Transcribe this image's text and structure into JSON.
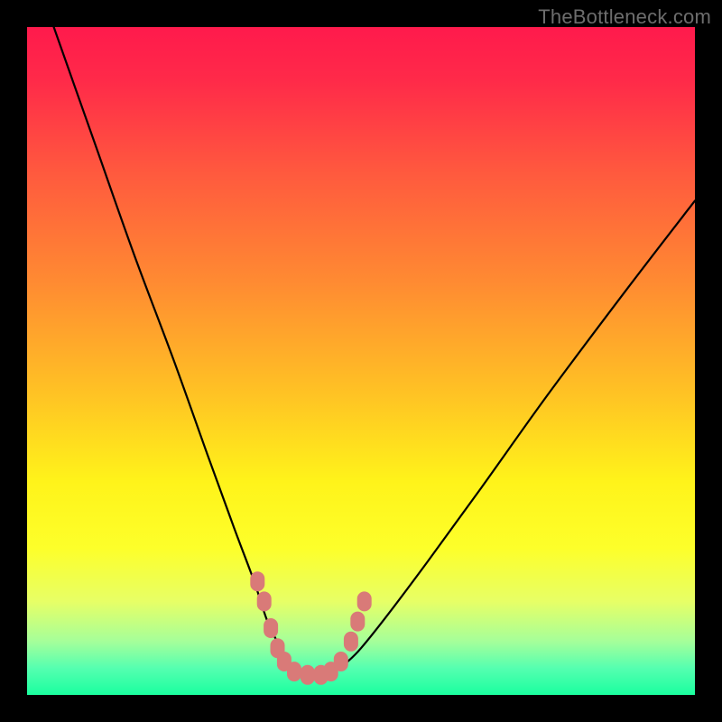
{
  "watermark": {
    "text": "TheBottleneck.com"
  },
  "colors": {
    "frame": "#000000",
    "curve": "#000000",
    "marker": "#d97a78",
    "gradient_stops": [
      {
        "offset": 0.0,
        "color": "#ff1a4c"
      },
      {
        "offset": 0.08,
        "color": "#ff2a49"
      },
      {
        "offset": 0.22,
        "color": "#ff5a3e"
      },
      {
        "offset": 0.38,
        "color": "#ff8a32"
      },
      {
        "offset": 0.55,
        "color": "#ffc324"
      },
      {
        "offset": 0.68,
        "color": "#fff31a"
      },
      {
        "offset": 0.78,
        "color": "#fdff2a"
      },
      {
        "offset": 0.86,
        "color": "#e7ff66"
      },
      {
        "offset": 0.92,
        "color": "#a5ff9a"
      },
      {
        "offset": 0.96,
        "color": "#55ffb0"
      },
      {
        "offset": 1.0,
        "color": "#1aff9f"
      }
    ]
  },
  "chart_data": {
    "type": "line",
    "title": "",
    "xlabel": "",
    "ylabel": "",
    "xlim": [
      0,
      100
    ],
    "ylim": [
      0,
      100
    ],
    "note": "Axes are unlabeled in the source image; values are relative percentages of the plot area (0 = bottom/left, 100 = top/right). The curve depicts a bottleneck-style V: steep descent from top-left to a flat minimum near x≈38–46, then a shallower rise toward the right.",
    "series": [
      {
        "name": "bottleneck-curve",
        "x": [
          4,
          10,
          16,
          22,
          27,
          31,
          34,
          36,
          38,
          40,
          42,
          44,
          46,
          48,
          50,
          54,
          60,
          68,
          78,
          90,
          100
        ],
        "values": [
          100,
          83,
          66,
          50,
          36,
          25,
          17,
          11,
          7,
          4,
          3,
          3,
          3.5,
          5,
          7,
          12,
          20,
          31,
          45,
          61,
          74
        ]
      }
    ],
    "markers": {
      "name": "highlighted-points",
      "note": "Pink rounded markers clustered around the curve minimum.",
      "points": [
        {
          "x": 34.5,
          "y": 17
        },
        {
          "x": 35.5,
          "y": 14
        },
        {
          "x": 36.5,
          "y": 10
        },
        {
          "x": 37.5,
          "y": 7
        },
        {
          "x": 38.5,
          "y": 5
        },
        {
          "x": 40.0,
          "y": 3.5
        },
        {
          "x": 42.0,
          "y": 3
        },
        {
          "x": 44.0,
          "y": 3
        },
        {
          "x": 45.5,
          "y": 3.5
        },
        {
          "x": 47.0,
          "y": 5
        },
        {
          "x": 48.5,
          "y": 8
        },
        {
          "x": 49.5,
          "y": 11
        },
        {
          "x": 50.5,
          "y": 14
        }
      ]
    }
  }
}
